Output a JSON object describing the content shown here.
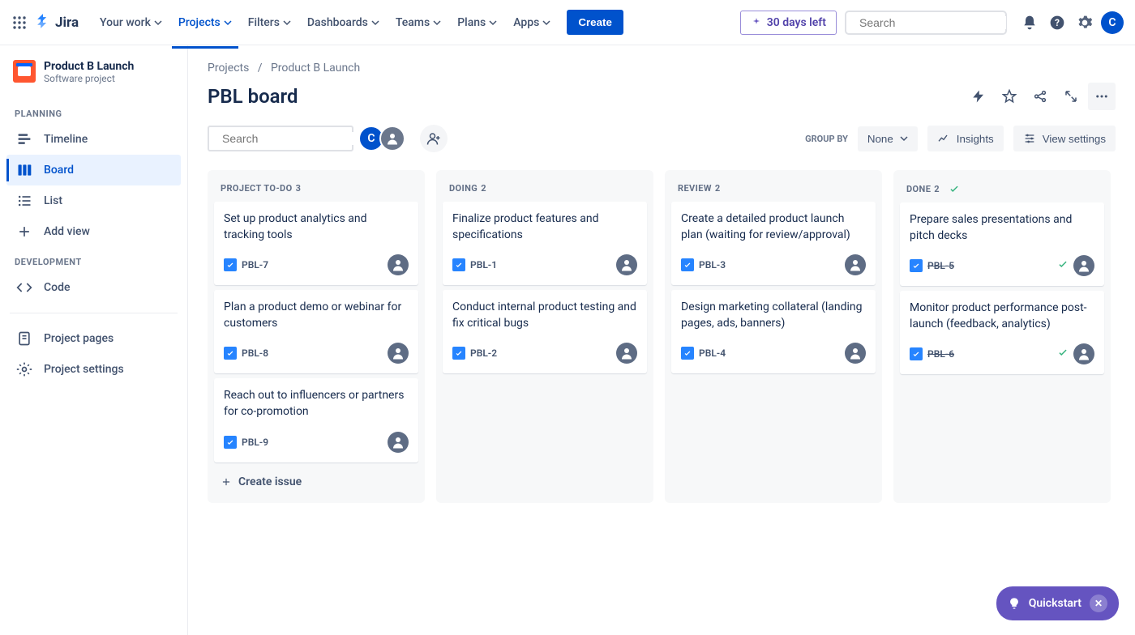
{
  "brand": "Jira",
  "nav": {
    "items": [
      {
        "label": "Your work"
      },
      {
        "label": "Projects",
        "active": true
      },
      {
        "label": "Filters"
      },
      {
        "label": "Dashboards"
      },
      {
        "label": "Teams"
      },
      {
        "label": "Plans"
      },
      {
        "label": "Apps"
      }
    ],
    "create": "Create",
    "days_left": "30 days left",
    "search_placeholder": "Search",
    "avatar_initial": "C"
  },
  "sidebar": {
    "project_name": "Product B Launch",
    "project_sub": "Software project",
    "section_planning": "PLANNING",
    "timeline": "Timeline",
    "board": "Board",
    "list": "List",
    "add_view": "Add view",
    "section_development": "DEVELOPMENT",
    "code": "Code",
    "project_pages": "Project pages",
    "project_settings": "Project settings"
  },
  "breadcrumb": {
    "projects": "Projects",
    "project": "Product B Launch"
  },
  "board": {
    "title": "PBL board",
    "search_placeholder": "Search",
    "groupby_label": "GROUP BY",
    "groupby_value": "None",
    "insights": "Insights",
    "view_settings": "View settings",
    "create_issue": "Create issue"
  },
  "columns": [
    {
      "name": "PROJECT TO-DO",
      "count": "3",
      "done": false,
      "cards": [
        {
          "title": "Set up product analytics and tracking tools",
          "key": "PBL-7",
          "strike": false
        },
        {
          "title": "Plan a product demo or webinar for customers",
          "key": "PBL-8",
          "strike": false
        },
        {
          "title": "Reach out to influencers or partners for co-promotion",
          "key": "PBL-9",
          "strike": false
        }
      ],
      "show_create": true
    },
    {
      "name": "DOING",
      "count": "2",
      "done": false,
      "cards": [
        {
          "title": "Finalize product features and specifications",
          "key": "PBL-1",
          "strike": false
        },
        {
          "title": "Conduct internal product testing and fix critical bugs",
          "key": "PBL-2",
          "strike": false
        }
      ]
    },
    {
      "name": "REVIEW",
      "count": "2",
      "done": false,
      "cards": [
        {
          "title": "Create a detailed product launch plan (waiting for review/approval)",
          "key": "PBL-3",
          "strike": false
        },
        {
          "title": "Design marketing collateral (landing pages, ads, banners)",
          "key": "PBL-4",
          "strike": false
        }
      ]
    },
    {
      "name": "DONE",
      "count": "2",
      "done": true,
      "cards": [
        {
          "title": "Prepare sales presentations and pitch decks",
          "key": "PBL-5",
          "strike": true
        },
        {
          "title": "Monitor product performance post-launch (feedback, analytics)",
          "key": "PBL-6",
          "strike": true
        }
      ]
    }
  ],
  "quickstart": "Quickstart"
}
